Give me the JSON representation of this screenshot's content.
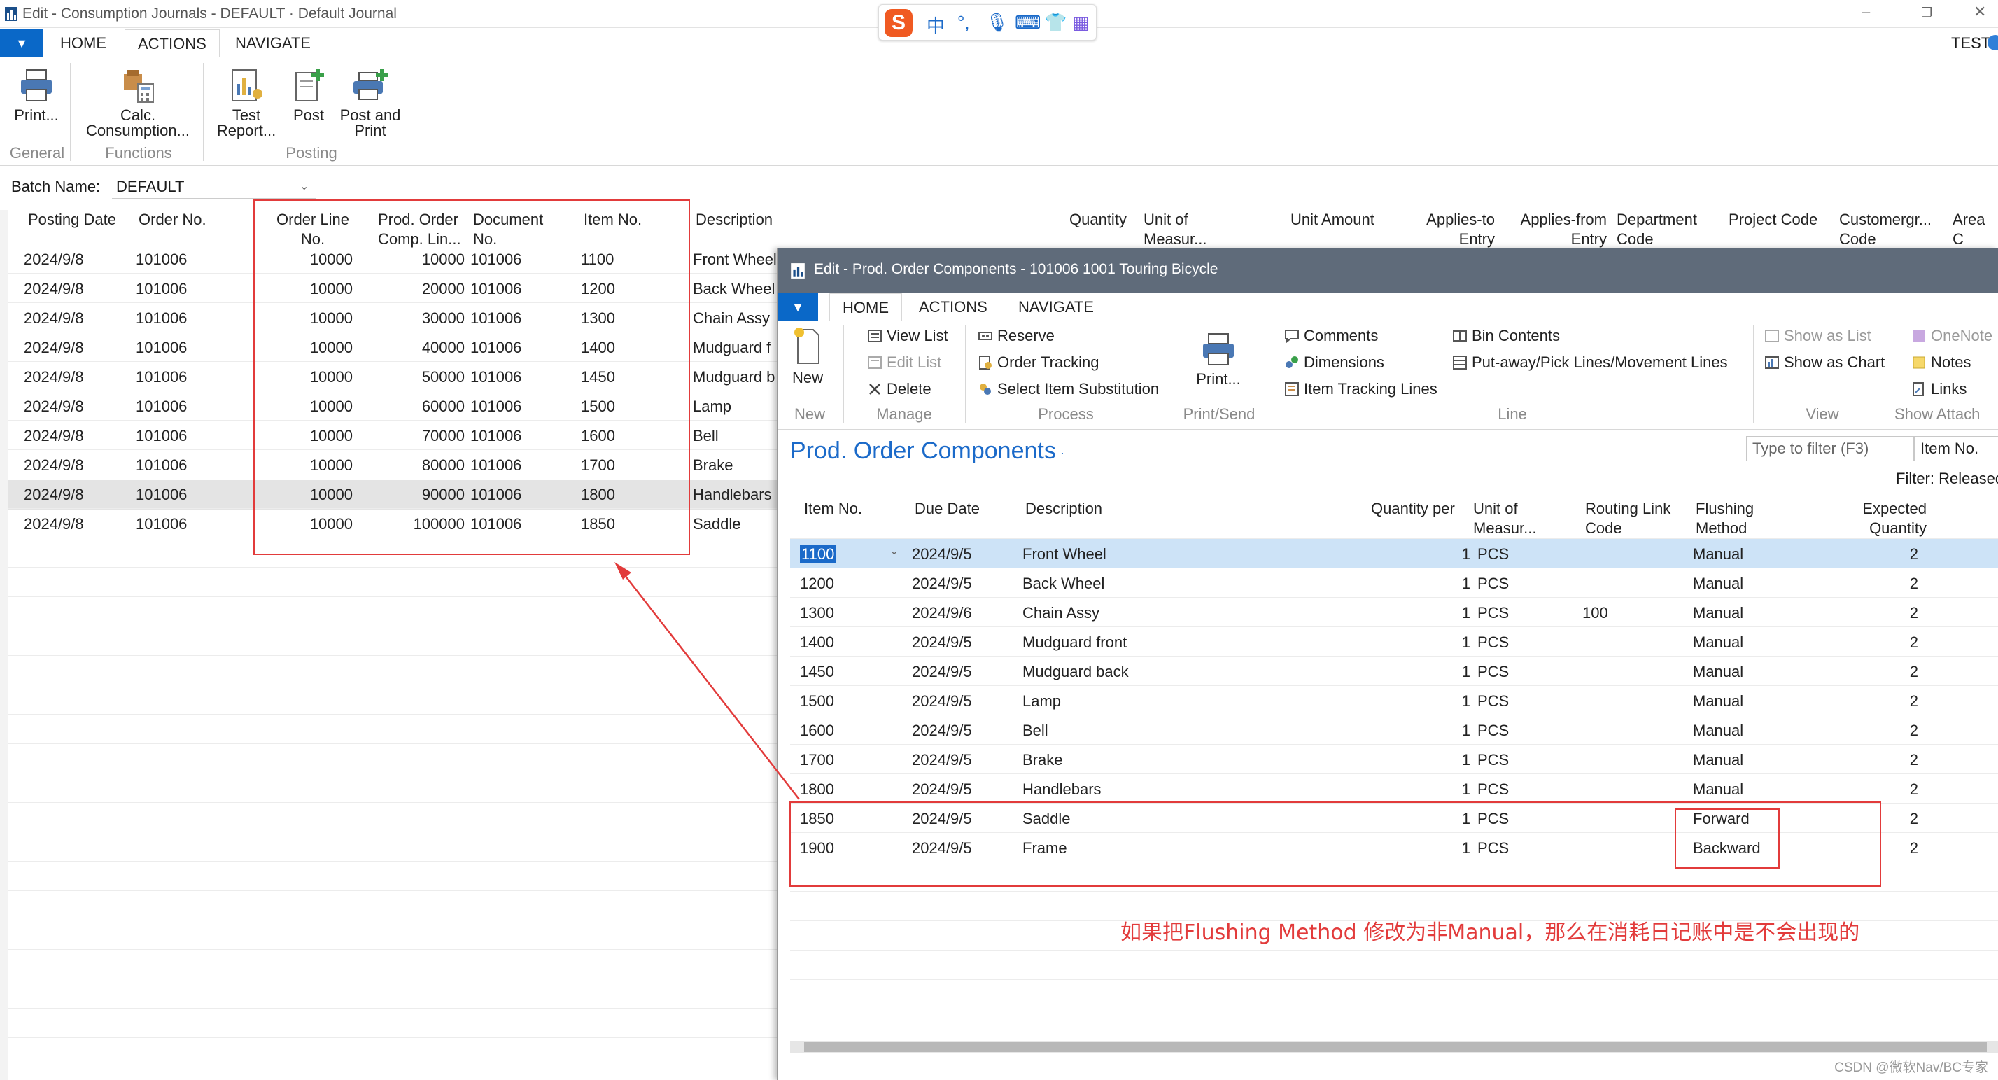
{
  "window1": {
    "title": "Edit - Consumption Journals - DEFAULT · Default Journal",
    "user": "TEST",
    "tabs": [
      "HOME",
      "ACTIONS",
      "NAVIGATE"
    ],
    "ribbon": {
      "print": "Print...",
      "calc": [
        "Calc.",
        "Consumption..."
      ],
      "test": [
        "Test",
        "Report..."
      ],
      "post": "Post",
      "post_print": [
        "Post and",
        "Print"
      ],
      "groups": [
        "General",
        "Functions",
        "Posting"
      ]
    },
    "batch_label": "Batch Name:",
    "batch_value": "DEFAULT",
    "columns": [
      [
        "Posting Date",
        ""
      ],
      [
        "Order No.",
        ""
      ],
      [
        "Order Line",
        "No."
      ],
      [
        "Prod. Order",
        "Comp. Lin..."
      ],
      [
        "Document",
        "No."
      ],
      [
        "Item No.",
        ""
      ],
      [
        "Description",
        ""
      ],
      [
        "Quantity",
        ""
      ],
      [
        "Unit of",
        "Measur..."
      ],
      [
        "Unit Amount",
        ""
      ],
      [
        "Applies-to",
        "Entry"
      ],
      [
        "Applies-from",
        "Entry"
      ],
      [
        "Department",
        "Code"
      ],
      [
        "Project Code",
        ""
      ],
      [
        "Customergr...",
        "Code"
      ],
      [
        "Area C",
        ""
      ]
    ],
    "rows": [
      [
        "2024/9/8",
        "101006",
        "10000",
        "10000",
        "101006",
        "1100",
        "Front Wheel"
      ],
      [
        "2024/9/8",
        "101006",
        "10000",
        "20000",
        "101006",
        "1200",
        "Back Wheel"
      ],
      [
        "2024/9/8",
        "101006",
        "10000",
        "30000",
        "101006",
        "1300",
        "Chain Assy"
      ],
      [
        "2024/9/8",
        "101006",
        "10000",
        "40000",
        "101006",
        "1400",
        "Mudguard f"
      ],
      [
        "2024/9/8",
        "101006",
        "10000",
        "50000",
        "101006",
        "1450",
        "Mudguard b"
      ],
      [
        "2024/9/8",
        "101006",
        "10000",
        "60000",
        "101006",
        "1500",
        "Lamp"
      ],
      [
        "2024/9/8",
        "101006",
        "10000",
        "70000",
        "101006",
        "1600",
        "Bell"
      ],
      [
        "2024/9/8",
        "101006",
        "10000",
        "80000",
        "101006",
        "1700",
        "Brake"
      ],
      [
        "2024/9/8",
        "101006",
        "10000",
        "90000",
        "101006",
        "1800",
        "Handlebars"
      ],
      [
        "2024/9/8",
        "101006",
        "10000",
        "100000",
        "101006",
        "1850",
        "Saddle"
      ]
    ]
  },
  "window2": {
    "title": "Edit - Prod. Order Components - 101006 1001 Touring Bicycle",
    "tabs": [
      "HOME",
      "ACTIONS",
      "NAVIGATE"
    ],
    "ribbon": {
      "new": "New",
      "view_list": "View List",
      "edit_list": "Edit List",
      "delete": "Delete",
      "reserve": "Reserve",
      "order_tracking": "Order Tracking",
      "select_item_sub": "Select Item Substitution",
      "print": "Print...",
      "comments": "Comments",
      "dimensions": "Dimensions",
      "item_tracking": "Item Tracking Lines",
      "bin_contents": "Bin Contents",
      "putaway": "Put-away/Pick Lines/Movement Lines",
      "show_list": "Show as List",
      "show_chart": "Show as Chart",
      "onenote": "OneNote",
      "notes": "Notes",
      "links": "Links",
      "groups": [
        "New",
        "Manage",
        "Process",
        "Print/Send",
        "Line",
        "View",
        "Show Attach"
      ]
    },
    "page_title": "Prod. Order Components",
    "filter_placeholder": "Type to filter (F3)",
    "filter_field": "Item No.",
    "filter_status": "Filter: Released",
    "columns": [
      [
        "Item No.",
        ""
      ],
      [
        "Due Date",
        ""
      ],
      [
        "Description",
        ""
      ],
      [
        "Quantity per",
        ""
      ],
      [
        "Unit of",
        "Measur..."
      ],
      [
        "Routing Link",
        "Code"
      ],
      [
        "Flushing",
        "Method"
      ],
      [
        "Expected",
        "Quantity"
      ]
    ],
    "rows": [
      [
        "1100",
        "2024/9/5",
        "Front Wheel",
        "1",
        "PCS",
        "",
        "Manual",
        "2"
      ],
      [
        "1200",
        "2024/9/5",
        "Back Wheel",
        "1",
        "PCS",
        "",
        "Manual",
        "2"
      ],
      [
        "1300",
        "2024/9/6",
        "Chain Assy",
        "1",
        "PCS",
        "100",
        "Manual",
        "2"
      ],
      [
        "1400",
        "2024/9/5",
        "Mudguard front",
        "1",
        "PCS",
        "",
        "Manual",
        "2"
      ],
      [
        "1450",
        "2024/9/5",
        "Mudguard back",
        "1",
        "PCS",
        "",
        "Manual",
        "2"
      ],
      [
        "1500",
        "2024/9/5",
        "Lamp",
        "1",
        "PCS",
        "",
        "Manual",
        "2"
      ],
      [
        "1600",
        "2024/9/5",
        "Bell",
        "1",
        "PCS",
        "",
        "Manual",
        "2"
      ],
      [
        "1700",
        "2024/9/5",
        "Brake",
        "1",
        "PCS",
        "",
        "Manual",
        "2"
      ],
      [
        "1800",
        "2024/9/5",
        "Handlebars",
        "1",
        "PCS",
        "",
        "Manual",
        "2"
      ],
      [
        "1850",
        "2024/9/5",
        "Saddle",
        "1",
        "PCS",
        "",
        "Forward",
        "2"
      ],
      [
        "1900",
        "2024/9/5",
        "Frame",
        "1",
        "PCS",
        "",
        "Backward",
        "2"
      ]
    ]
  },
  "annotation": "如果把Flushing Method 修改为非Manual，那么在消耗日记账中是不会出现的",
  "ime": {
    "label": "中"
  },
  "watermark": "CSDN @微软Nav/BC专家",
  "colors": {
    "accent": "#1b6ac9",
    "annotation": "#e23b3b",
    "title2_bg": "#5f6b7a"
  }
}
